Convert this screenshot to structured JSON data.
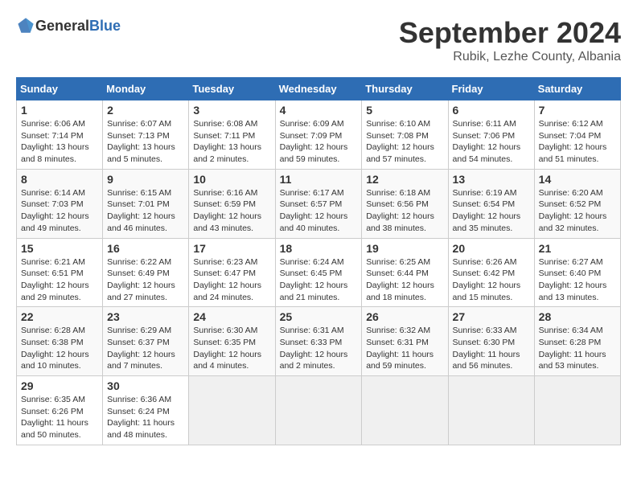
{
  "header": {
    "logo_general": "General",
    "logo_blue": "Blue",
    "month": "September 2024",
    "location": "Rubik, Lezhe County, Albania"
  },
  "columns": [
    "Sunday",
    "Monday",
    "Tuesday",
    "Wednesday",
    "Thursday",
    "Friday",
    "Saturday"
  ],
  "weeks": [
    [
      {
        "day": "1",
        "sunrise": "6:06 AM",
        "sunset": "7:14 PM",
        "daylight": "13 hours and 8 minutes."
      },
      {
        "day": "2",
        "sunrise": "6:07 AM",
        "sunset": "7:13 PM",
        "daylight": "13 hours and 5 minutes."
      },
      {
        "day": "3",
        "sunrise": "6:08 AM",
        "sunset": "7:11 PM",
        "daylight": "13 hours and 2 minutes."
      },
      {
        "day": "4",
        "sunrise": "6:09 AM",
        "sunset": "7:09 PM",
        "daylight": "12 hours and 59 minutes."
      },
      {
        "day": "5",
        "sunrise": "6:10 AM",
        "sunset": "7:08 PM",
        "daylight": "12 hours and 57 minutes."
      },
      {
        "day": "6",
        "sunrise": "6:11 AM",
        "sunset": "7:06 PM",
        "daylight": "12 hours and 54 minutes."
      },
      {
        "day": "7",
        "sunrise": "6:12 AM",
        "sunset": "7:04 PM",
        "daylight": "12 hours and 51 minutes."
      }
    ],
    [
      {
        "day": "8",
        "sunrise": "6:14 AM",
        "sunset": "7:03 PM",
        "daylight": "12 hours and 49 minutes."
      },
      {
        "day": "9",
        "sunrise": "6:15 AM",
        "sunset": "7:01 PM",
        "daylight": "12 hours and 46 minutes."
      },
      {
        "day": "10",
        "sunrise": "6:16 AM",
        "sunset": "6:59 PM",
        "daylight": "12 hours and 43 minutes."
      },
      {
        "day": "11",
        "sunrise": "6:17 AM",
        "sunset": "6:57 PM",
        "daylight": "12 hours and 40 minutes."
      },
      {
        "day": "12",
        "sunrise": "6:18 AM",
        "sunset": "6:56 PM",
        "daylight": "12 hours and 38 minutes."
      },
      {
        "day": "13",
        "sunrise": "6:19 AM",
        "sunset": "6:54 PM",
        "daylight": "12 hours and 35 minutes."
      },
      {
        "day": "14",
        "sunrise": "6:20 AM",
        "sunset": "6:52 PM",
        "daylight": "12 hours and 32 minutes."
      }
    ],
    [
      {
        "day": "15",
        "sunrise": "6:21 AM",
        "sunset": "6:51 PM",
        "daylight": "12 hours and 29 minutes."
      },
      {
        "day": "16",
        "sunrise": "6:22 AM",
        "sunset": "6:49 PM",
        "daylight": "12 hours and 27 minutes."
      },
      {
        "day": "17",
        "sunrise": "6:23 AM",
        "sunset": "6:47 PM",
        "daylight": "12 hours and 24 minutes."
      },
      {
        "day": "18",
        "sunrise": "6:24 AM",
        "sunset": "6:45 PM",
        "daylight": "12 hours and 21 minutes."
      },
      {
        "day": "19",
        "sunrise": "6:25 AM",
        "sunset": "6:44 PM",
        "daylight": "12 hours and 18 minutes."
      },
      {
        "day": "20",
        "sunrise": "6:26 AM",
        "sunset": "6:42 PM",
        "daylight": "12 hours and 15 minutes."
      },
      {
        "day": "21",
        "sunrise": "6:27 AM",
        "sunset": "6:40 PM",
        "daylight": "12 hours and 13 minutes."
      }
    ],
    [
      {
        "day": "22",
        "sunrise": "6:28 AM",
        "sunset": "6:38 PM",
        "daylight": "12 hours and 10 minutes."
      },
      {
        "day": "23",
        "sunrise": "6:29 AM",
        "sunset": "6:37 PM",
        "daylight": "12 hours and 7 minutes."
      },
      {
        "day": "24",
        "sunrise": "6:30 AM",
        "sunset": "6:35 PM",
        "daylight": "12 hours and 4 minutes."
      },
      {
        "day": "25",
        "sunrise": "6:31 AM",
        "sunset": "6:33 PM",
        "daylight": "12 hours and 2 minutes."
      },
      {
        "day": "26",
        "sunrise": "6:32 AM",
        "sunset": "6:31 PM",
        "daylight": "11 hours and 59 minutes."
      },
      {
        "day": "27",
        "sunrise": "6:33 AM",
        "sunset": "6:30 PM",
        "daylight": "11 hours and 56 minutes."
      },
      {
        "day": "28",
        "sunrise": "6:34 AM",
        "sunset": "6:28 PM",
        "daylight": "11 hours and 53 minutes."
      }
    ],
    [
      {
        "day": "29",
        "sunrise": "6:35 AM",
        "sunset": "6:26 PM",
        "daylight": "11 hours and 50 minutes."
      },
      {
        "day": "30",
        "sunrise": "6:36 AM",
        "sunset": "6:24 PM",
        "daylight": "11 hours and 48 minutes."
      },
      null,
      null,
      null,
      null,
      null
    ]
  ]
}
